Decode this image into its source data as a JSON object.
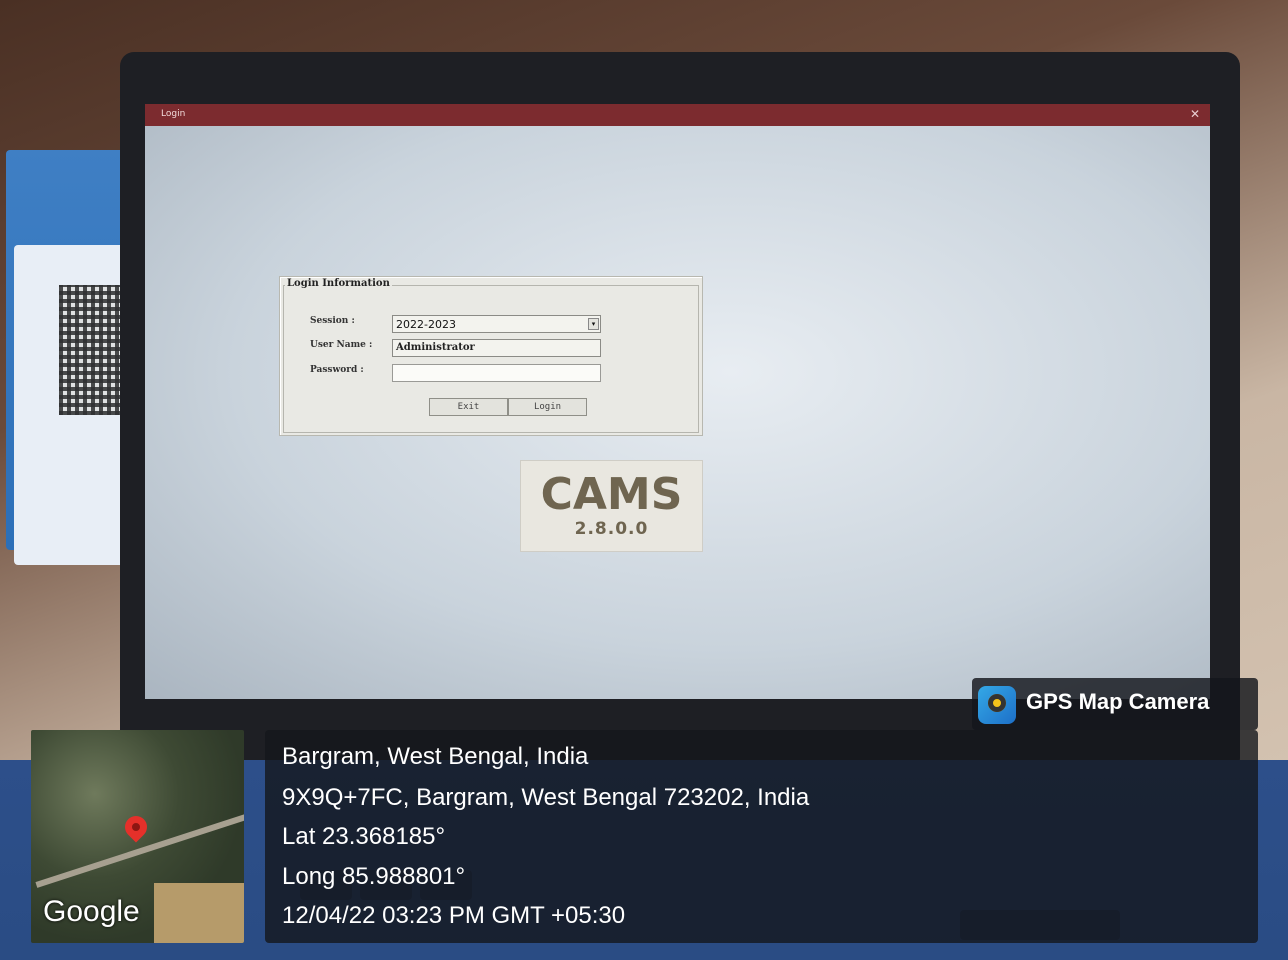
{
  "window": {
    "title": "Login",
    "close_glyph": "✕"
  },
  "login": {
    "group_title": "Login Information",
    "session_label": "Session :",
    "session_value": "2022-2023",
    "username_label": "User Name :",
    "username_value": "Administrator",
    "password_label": "Password :",
    "password_value": "",
    "exit_label": "Exit",
    "login_label": "Login"
  },
  "app": {
    "name": "CAMS",
    "version": "2.8.0.0"
  },
  "overlay": {
    "brand": "GPS Map Camera",
    "place": "Bargram, West Bengal, India",
    "address": "9X9Q+7FC, Bargram, West Bengal 723202, India",
    "lat": "Lat 23.368185°",
    "long": "Long 85.988801°",
    "datetime": "12/04/22 03:23 PM GMT +05:30",
    "map_provider": "Google"
  },
  "colors": {
    "titlebar": "#7c2b2f",
    "cams_text": "#6f6550",
    "overlay_bg": "#14161c"
  }
}
